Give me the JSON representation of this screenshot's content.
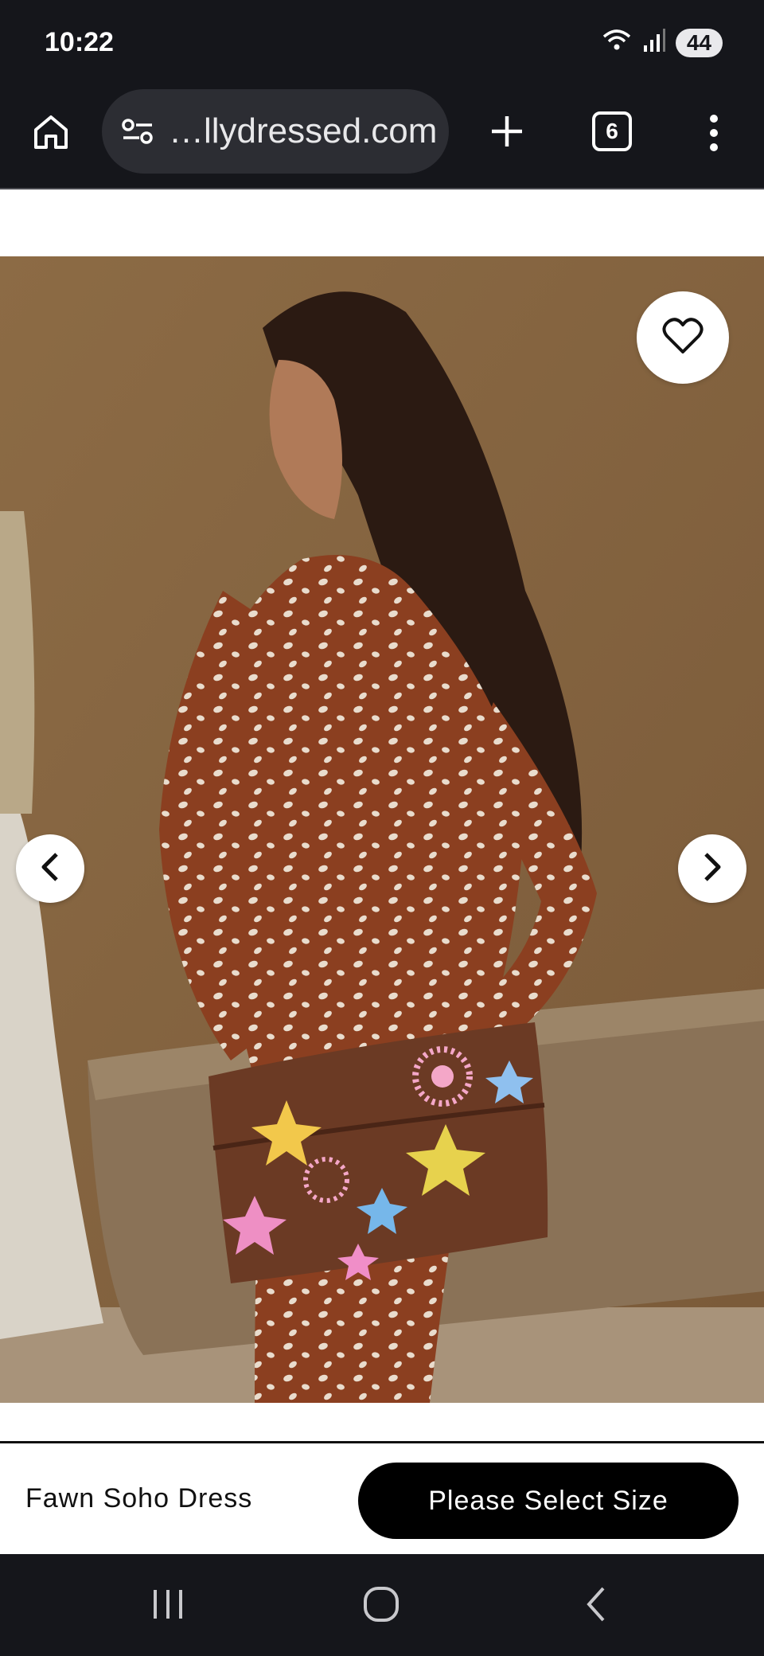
{
  "status_bar": {
    "time": "10:22",
    "battery": "44",
    "wifi_icon": "wifi-icon",
    "signal_icon": "signal-icon"
  },
  "browser": {
    "url": "…llydressed.com",
    "tab_count": "6",
    "icons": {
      "home": "home-icon",
      "site_settings": "tune-icon",
      "new_tab": "plus-icon",
      "menu": "more-vert-icon"
    }
  },
  "product": {
    "image_alt_icons": {
      "favorite": "heart-icon",
      "prev": "chevron-left-icon",
      "next": "chevron-right-icon"
    }
  },
  "purchase_bar": {
    "product_name": "Fawn Soho Dress",
    "button_label": "Please Select Size"
  },
  "nav_bar": {
    "recents": "recents-icon",
    "home": "home-circle-icon",
    "back": "back-icon"
  },
  "colors": {
    "chrome_bg": "#15161b",
    "omnibox_bg": "#2c2d33",
    "button_bg": "#000000",
    "dress": "#8b3f20"
  }
}
